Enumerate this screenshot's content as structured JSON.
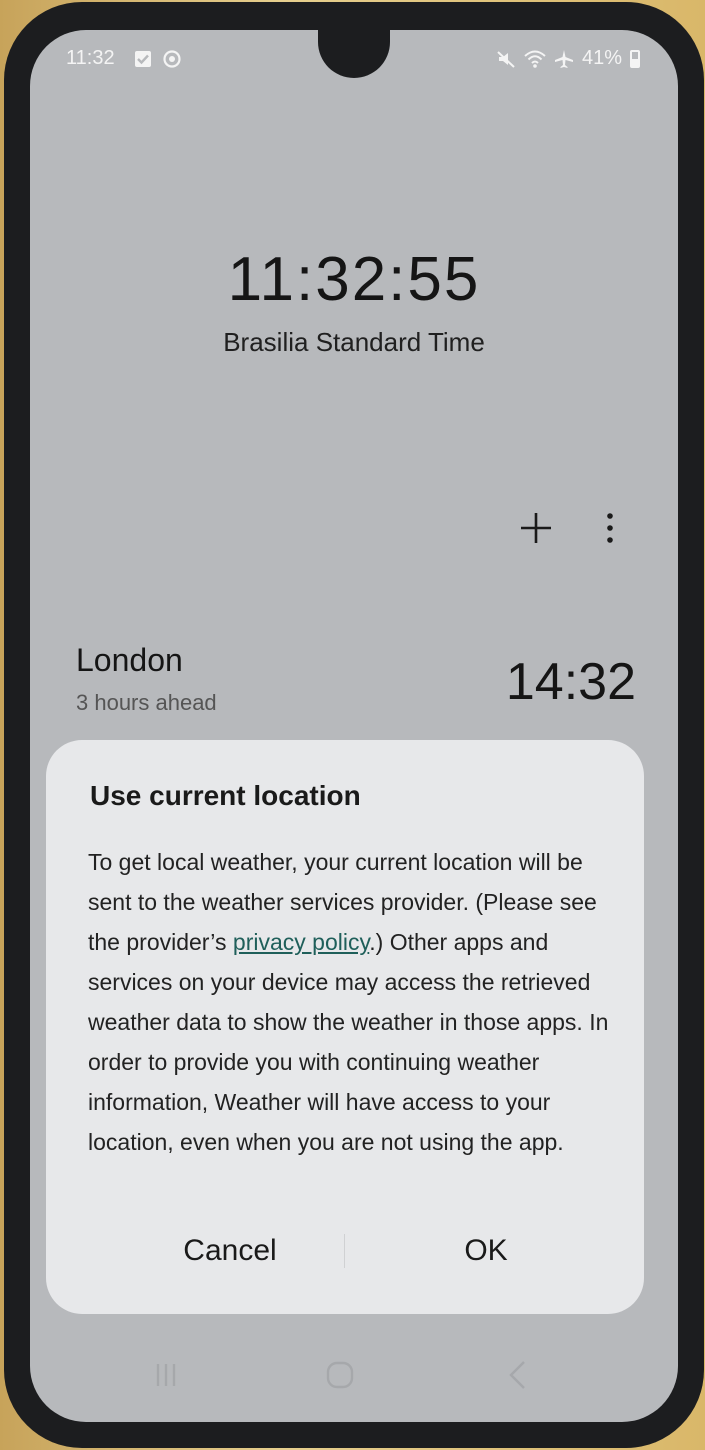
{
  "status_bar": {
    "time": "11:32",
    "battery": "41%",
    "icons": [
      "calendar-check-icon",
      "clock-icon",
      "mute-icon",
      "wifi-icon",
      "airplane-icon",
      "battery-icon"
    ]
  },
  "clock": {
    "main_time": "11:32:55",
    "timezone": "Brasilia Standard Time"
  },
  "toolbar": {
    "icons": [
      "add-icon",
      "more-vert-icon"
    ]
  },
  "world_clock": {
    "city": "London",
    "difference": "3 hours ahead",
    "time": "14:32"
  },
  "dialog": {
    "title": "Use current location",
    "body_intro": "To get local weather, your current location will be sent to the weather services provider. (Please see the provider’s ",
    "privacy_link": "privacy policy",
    "body_rest": ".) Other apps and services on your device may access the retrieved weather data to show the weather in those apps. In order to provide you with continuing weather information, Weather will have access to your location, even when you are not using the app.",
    "cancel_label": "Cancel",
    "ok_label": "OK"
  },
  "nav_bar": {
    "icons": [
      "recent-apps-icon",
      "home-icon",
      "back-icon"
    ]
  },
  "colors": {
    "screen_bg": "#b7b9bc",
    "dialog_bg": "#e7e8ea",
    "link": "#1f5f5a"
  }
}
